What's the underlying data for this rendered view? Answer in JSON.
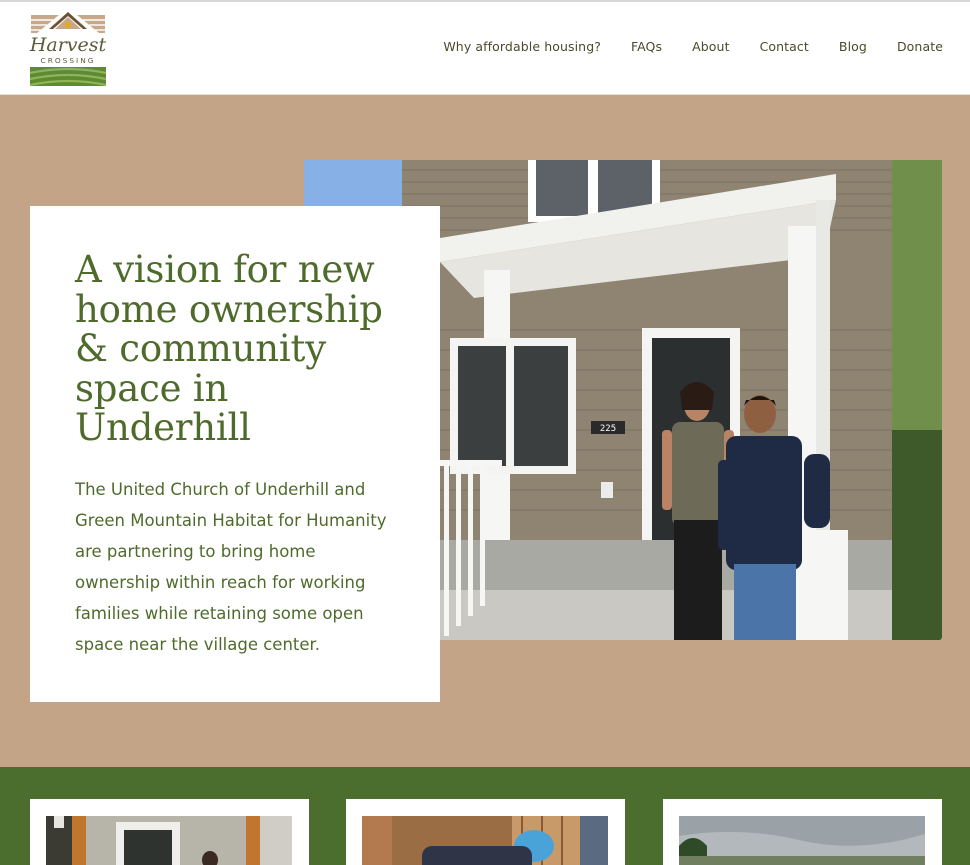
{
  "brand": {
    "name": "Harvest",
    "tagline": "CROSSING"
  },
  "nav": {
    "items": [
      {
        "label": "Why affordable housing?"
      },
      {
        "label": "FAQs"
      },
      {
        "label": "About"
      },
      {
        "label": "Contact"
      },
      {
        "label": "Blog"
      },
      {
        "label": "Donate"
      }
    ]
  },
  "hero": {
    "headline": "A vision for new home ownership & community space in Underhill",
    "body": "The United Church of Underhill and Green Mountain Habitat for Humanity are partnering to bring home ownership within reach for working families while retaining some open space near the village center.",
    "house_number": "225"
  },
  "colors": {
    "brand_green": "#4f6b2c",
    "band_green": "#4b6d2d",
    "tan": "#c4a486",
    "nav_text": "#4a4a2e"
  },
  "icons": {
    "logo": "house-roof-logo"
  }
}
